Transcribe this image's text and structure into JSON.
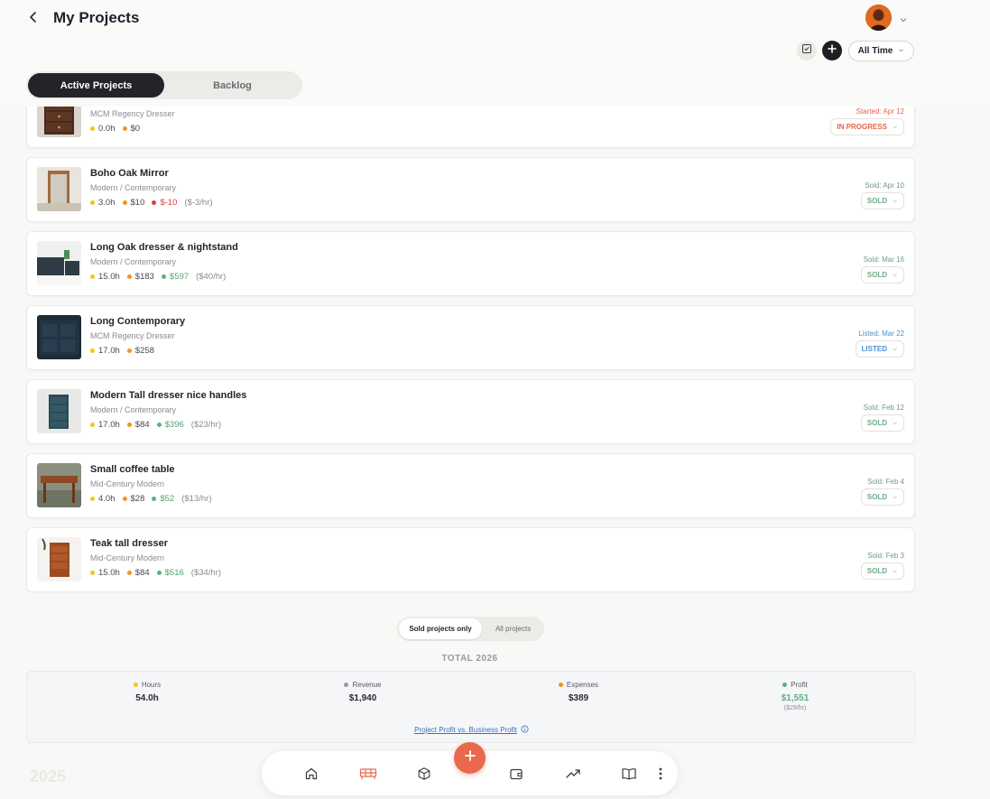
{
  "header": {
    "title": "My Projects",
    "time_filter": "All Time",
    "tabs": [
      {
        "label": "Active Projects",
        "active": true
      },
      {
        "label": "Backlog",
        "active": false
      }
    ]
  },
  "colors": {
    "hours": "#f5c518",
    "expenses": "#f0961f",
    "profit": "#5fae7d",
    "loss": "#e03a3a",
    "revenue": "#9a999e",
    "accent": "#e8694e"
  },
  "projects": [
    {
      "name": "",
      "style": "MCM Regency Dresser",
      "hours": "0.0h",
      "expenses": "$0",
      "profit": "",
      "rate": "",
      "date": "Started: Apr 12",
      "status": "IN PROGRESS"
    },
    {
      "name": "Boho Oak Mirror",
      "style": "Modern / Contemporary",
      "hours": "3.0h",
      "expenses": "$10",
      "profit": "$-10",
      "rate": "($-3/hr)",
      "date": "Sold: Apr 10",
      "status": "SOLD"
    },
    {
      "name": "Long Oak dresser & nightstand",
      "style": "Modern / Contemporary",
      "hours": "15.0h",
      "expenses": "$183",
      "profit": "$597",
      "rate": "($40/hr)",
      "date": "Sold: Mar 16",
      "status": "SOLD"
    },
    {
      "name": "Long Contemporary",
      "style": "MCM Regency Dresser",
      "hours": "17.0h",
      "expenses": "$258",
      "profit": "",
      "rate": "",
      "date": "Listed: Mar 22",
      "status": "LISTED"
    },
    {
      "name": "Modern Tall dresser nice handles",
      "style": "Modern / Contemporary",
      "hours": "17.0h",
      "expenses": "$84",
      "profit": "$396",
      "rate": "($23/hr)",
      "date": "Sold: Feb 12",
      "status": "SOLD"
    },
    {
      "name": "Small coffee table",
      "style": "Mid-Century Modern",
      "hours": "4.0h",
      "expenses": "$28",
      "profit": "$52",
      "rate": "($13/hr)",
      "date": "Sold: Feb 4",
      "status": "SOLD"
    },
    {
      "name": "Teak tall dresser",
      "style": "Mid-Century Modern",
      "hours": "15.0h",
      "expenses": "$84",
      "profit": "$516",
      "rate": "($34/hr)",
      "date": "Sold: Feb 3",
      "status": "SOLD"
    }
  ],
  "summary": {
    "toggle_sold": "Sold projects only",
    "toggle_all": "All projects",
    "title": "TOTAL 2026",
    "hours_label": "Hours",
    "hours": "54.0h",
    "revenue_label": "Revenue",
    "revenue": "$1,940",
    "expenses_label": "Expenses",
    "expenses": "$389",
    "profit_label": "Profit",
    "profit": "$1,551",
    "profit_rate": "($29/hr)",
    "link": "Project Profit vs. Business Profit"
  },
  "year_label": "2025",
  "nav": [
    "home-icon",
    "furniture-icon",
    "box-icon",
    "wallet-icon",
    "trend-icon",
    "book-icon",
    "more-icon"
  ]
}
